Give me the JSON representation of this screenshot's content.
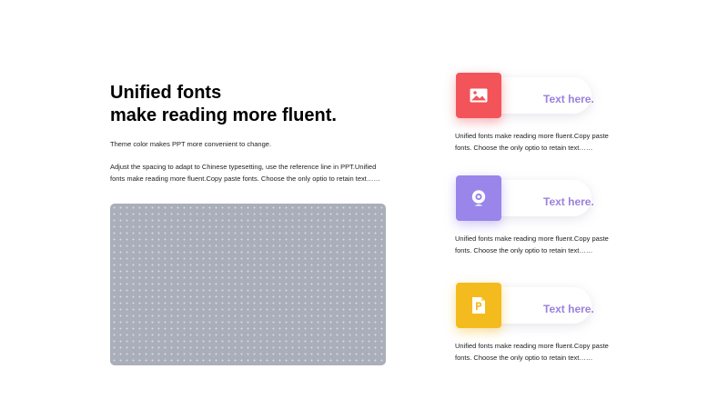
{
  "heading": {
    "line1": "Unified fonts",
    "line2": "make reading more fluent."
  },
  "intro": {
    "paragraph1": "Theme  color makes PPT more convenient to change.",
    "paragraph2": "Adjust the spacing to adapt to Chinese typesetting, use the reference line in PPT.Unified fonts make reading more fluent.Copy paste fonts. Choose the only optio to retain text……"
  },
  "features": [
    {
      "icon": "image-icon",
      "color": "#f2545a",
      "label": "Text here.",
      "description": "Unified fonts make reading more fluent.Copy paste fonts. Choose the only optio to retain text……"
    },
    {
      "icon": "webcam-icon",
      "color": "#9a85ea",
      "label": "Text here.",
      "description": "Unified fonts make reading more fluent.Copy paste fonts. Choose the only optio to retain text……"
    },
    {
      "icon": "powerpoint-file-icon",
      "color": "#f4bb1e",
      "label": "Text here.",
      "description": "Unified fonts make reading more fluent.Copy paste fonts. Choose the only optio to retain text……"
    }
  ],
  "colors": {
    "accent_text": "#9b80dc",
    "placeholder": "#a9aeba"
  }
}
